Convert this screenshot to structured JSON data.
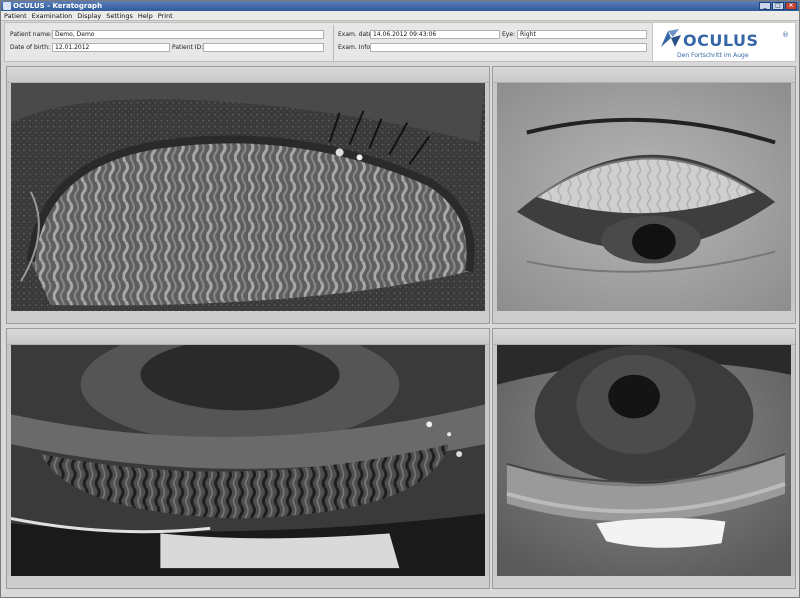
{
  "window": {
    "title": "OCULUS - Keratograph"
  },
  "menu": [
    "Patient",
    "Examination",
    "Display",
    "Settings",
    "Help",
    "Print"
  ],
  "patient": {
    "name_label": "Patient name:",
    "name_value": "Demo, Demo",
    "dob_label": "Date of birth:",
    "dob_value": "12.01.2012",
    "id_label": "Patient ID:",
    "id_value": ""
  },
  "exam": {
    "date_label": "Exam. date:",
    "date_value": "14.06.2012 09:43:06",
    "eye_label": "Eye:",
    "eye_value": "Right",
    "info_label": "Exam. Info:",
    "info_value": ""
  },
  "logo": {
    "text": "OCULUS",
    "registered": "®",
    "tagline": "Den Fortschritt im Auge"
  },
  "panels": [
    {
      "name": "upper-lid-meibography",
      "icon": "eyelid-image"
    },
    {
      "name": "upper-eye-photo",
      "icon": "eye-image"
    },
    {
      "name": "lower-lid-meibography",
      "icon": "eyelid-image"
    },
    {
      "name": "lower-eye-photo",
      "icon": "eye-image"
    }
  ],
  "colors": {
    "title_bar": "#2f5a9e",
    "logo_blue": "#3566a6",
    "panel_bg": "#c7c7c7"
  }
}
